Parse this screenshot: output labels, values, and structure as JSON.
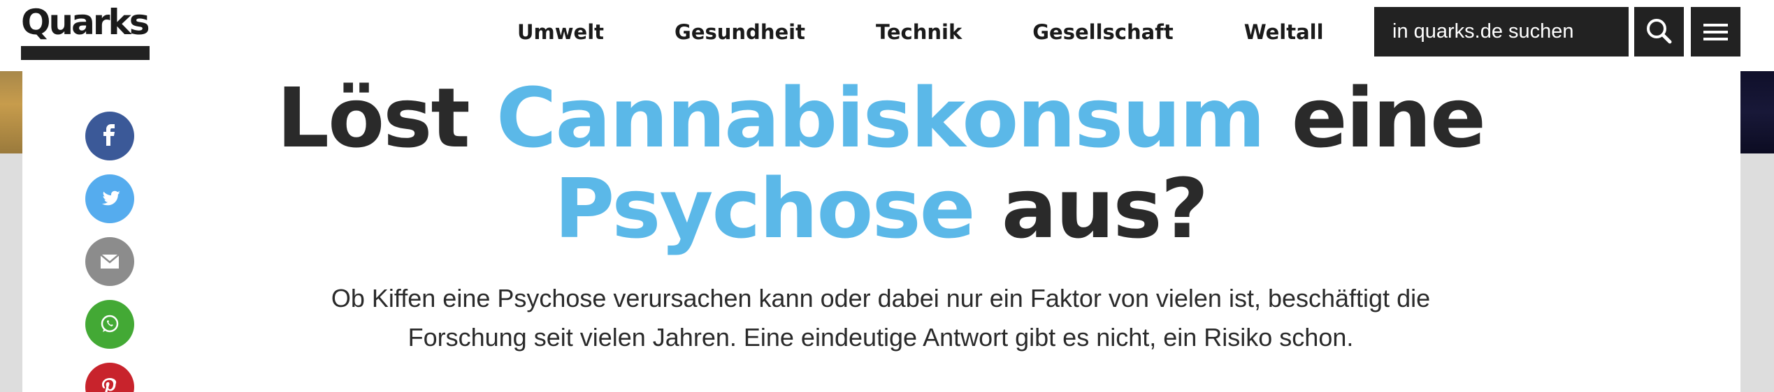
{
  "header": {
    "logo_text": "Quarks",
    "nav": [
      "Umwelt",
      "Gesundheit",
      "Technik",
      "Gesellschaft",
      "Weltall"
    ],
    "search_placeholder": "in quarks.de suchen"
  },
  "social": [
    "facebook-icon",
    "twitter-icon",
    "email-icon",
    "whatsapp-icon",
    "pinterest-icon"
  ],
  "colors": {
    "facebook": "#3b5998",
    "twitter": "#55acee",
    "email": "#8c8c8c",
    "whatsapp": "#43a935",
    "pinterest": "#c8232c",
    "highlight": "#5bb8e8",
    "dark": "#222222"
  },
  "article": {
    "headline": {
      "part1": "Löst ",
      "highlight1": "Cannabiskonsum",
      "part2": " eine",
      "highlight2": "Psychose",
      "part3": " aus?"
    },
    "teaser": "Ob Kiffen eine Psychose verursachen kann oder dabei nur ein Faktor von vielen ist, beschäftigt die Forschung seit vielen Jahren. Eine eindeutige Antwort gibt es nicht, ein Risiko schon."
  }
}
